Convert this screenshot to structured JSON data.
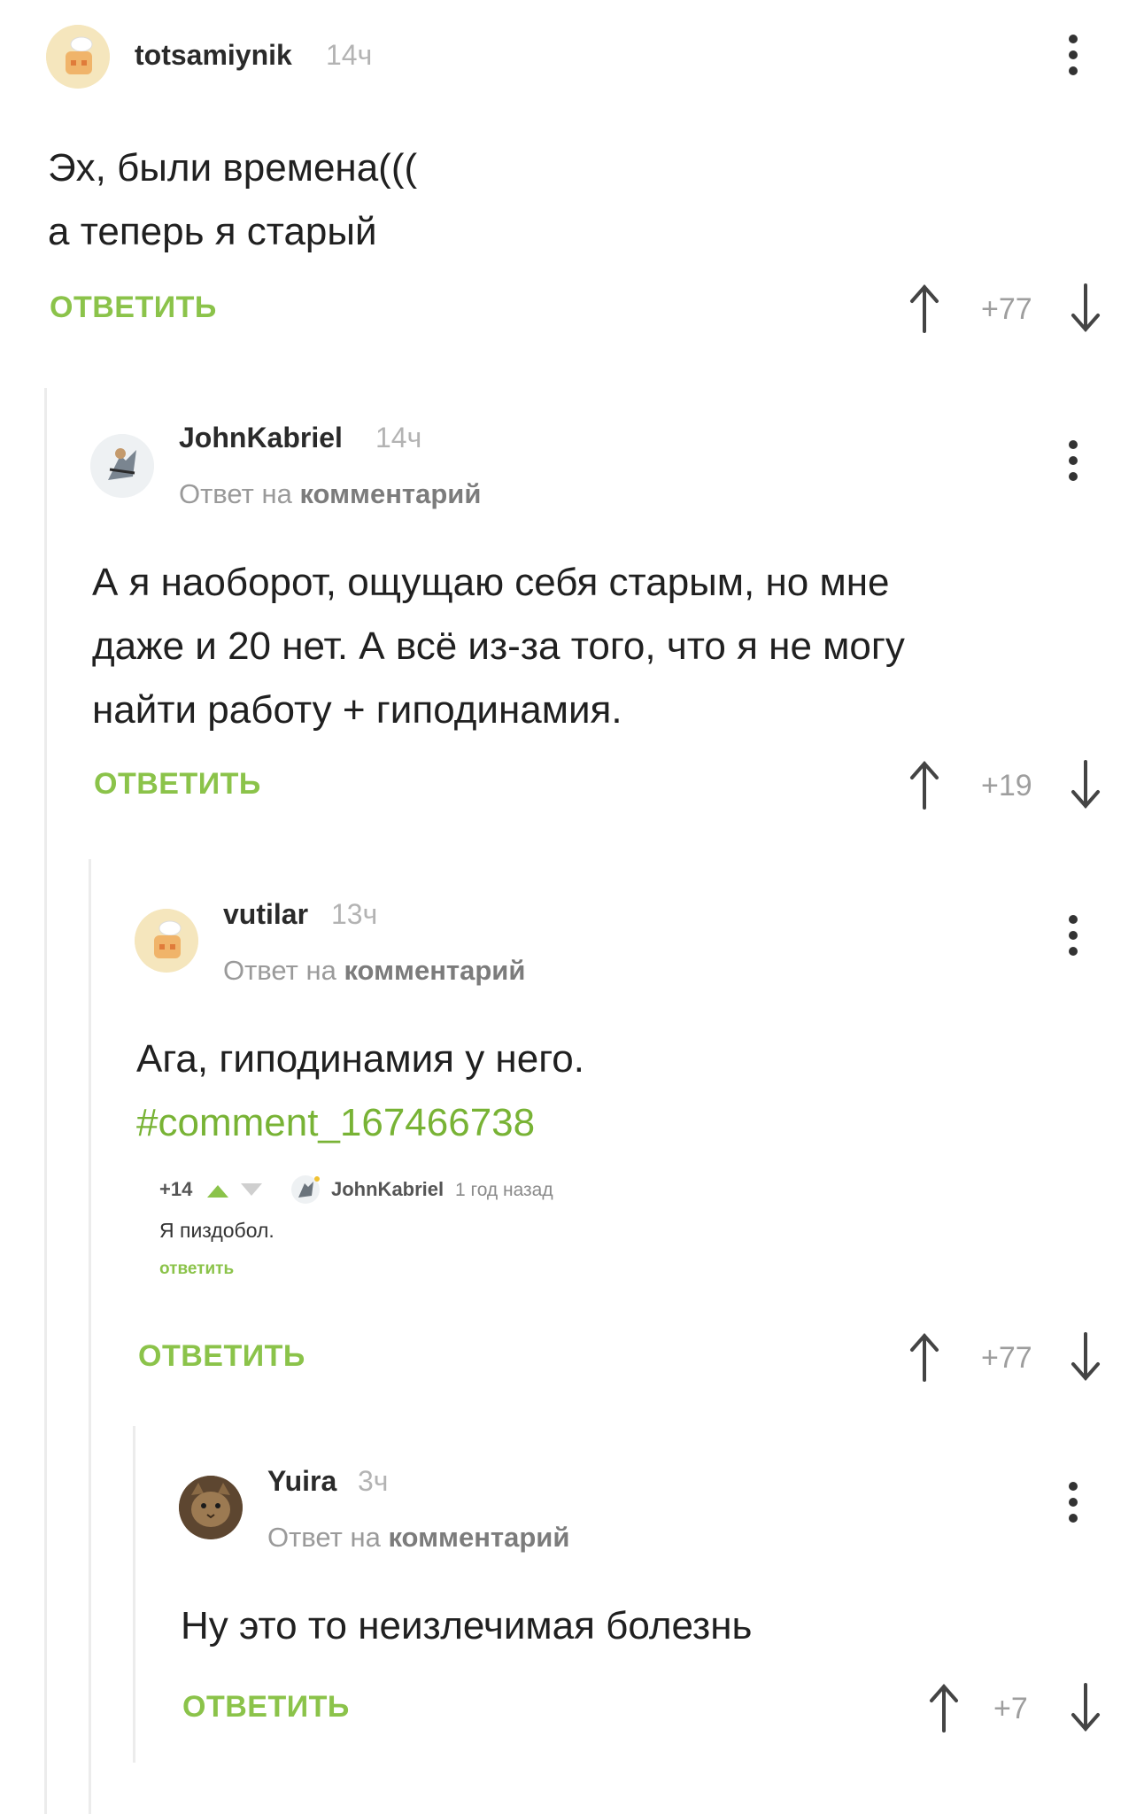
{
  "comments": [
    {
      "username": "totsamiynik",
      "time": "14ч",
      "lines": [
        "Эх, были времена(((",
        "а теперь я старый"
      ],
      "reply_label": "ОТВЕТИТЬ",
      "rating": "+77"
    },
    {
      "username": "JohnKabriel",
      "time": "14ч",
      "reply_prefix": "Ответ на",
      "reply_link": "комментарий",
      "lines": [
        "А я наоборот, ощущаю себя старым, но мне",
        "даже и 20 нет. А всё из-за того, что я не могу",
        "найти работу + гиподинамия."
      ],
      "reply_label": "ОТВЕТИТЬ",
      "rating": "+19"
    },
    {
      "username": "vutilar",
      "time": "13ч",
      "reply_prefix": "Ответ на",
      "reply_link": "комментарий",
      "lines": [
        "Ага, гиподинамия у него."
      ],
      "hashtag": "#comment_167466738",
      "reply_label": "ОТВЕТИТЬ",
      "rating": "+77",
      "embed": {
        "rating": "+14",
        "username": "JohnKabriel",
        "time": "1 год назад",
        "text": "Я пиздобол.",
        "reply_label": "ответить"
      }
    },
    {
      "username": "Yuira",
      "time": "3ч",
      "reply_prefix": "Ответ на",
      "reply_link": "комментарий",
      "lines": [
        "Ну это то неизлечимая болезнь"
      ],
      "reply_label": "ОТВЕТИТЬ",
      "rating": "+7"
    }
  ],
  "colors": {
    "accent_green": "#8bc34a",
    "link_green": "#78b335",
    "muted_gray": "#9e9e9e",
    "thread_line": "#ececec"
  },
  "icons": [
    "more-vertical-icon",
    "arrow-up-icon",
    "arrow-down-icon",
    "chef-avatar",
    "cat-avatar"
  ]
}
